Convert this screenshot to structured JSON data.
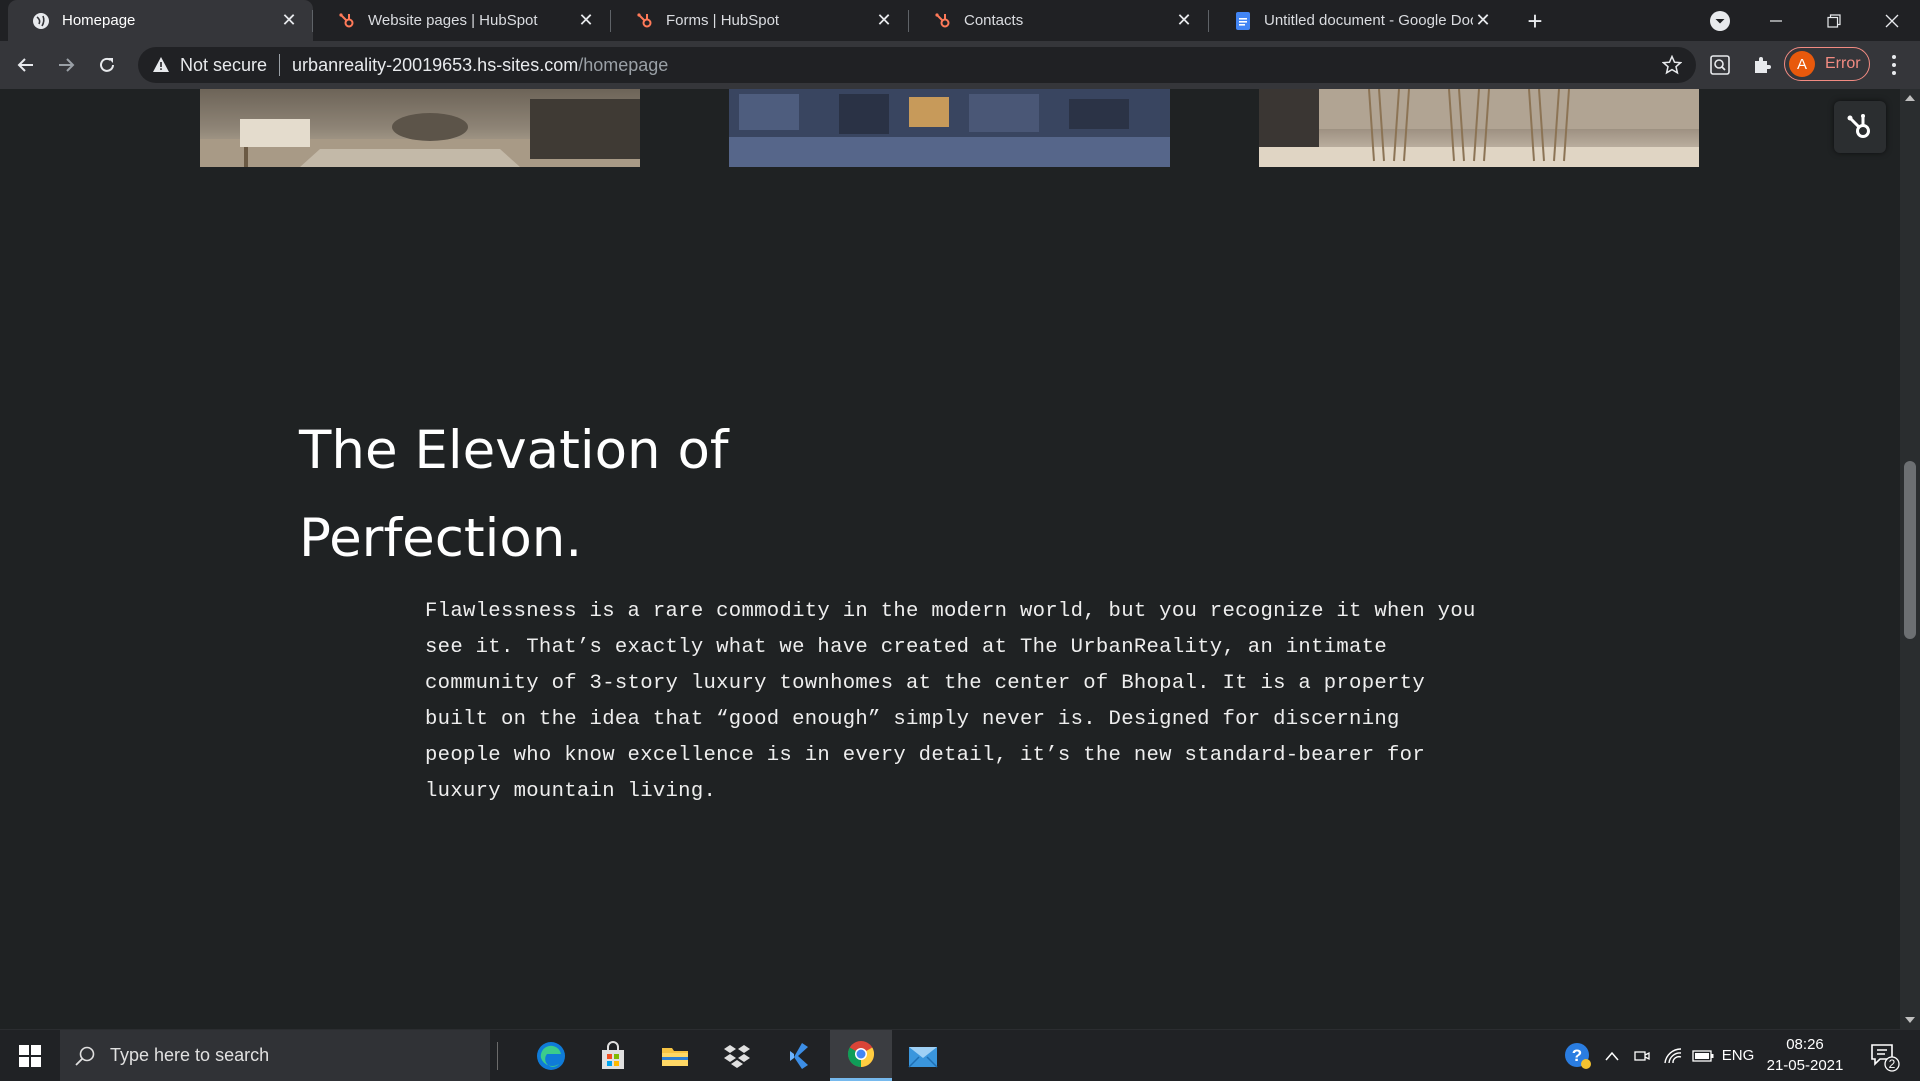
{
  "browser": {
    "tabs": [
      {
        "title": "Homepage",
        "favicon": "globe-icon",
        "active": true
      },
      {
        "title": "Website pages | HubSpot",
        "favicon": "hubspot-icon",
        "active": false
      },
      {
        "title": "Forms | HubSpot",
        "favicon": "hubspot-icon",
        "active": false
      },
      {
        "title": "Contacts",
        "favicon": "hubspot-icon",
        "active": false
      },
      {
        "title": "Untitled document - Google Docs",
        "favicon": "google-docs-icon",
        "active": false
      }
    ],
    "address": {
      "security_label": "Not secure",
      "host": "urbanreality-20019653.hs-sites.com",
      "path": "/homepage"
    },
    "profile": {
      "initial": "A",
      "status": "Error"
    }
  },
  "page": {
    "headline_line1": "The Elevation of",
    "headline_line2": "Perfection.",
    "body": "Flawlessness is a rare commodity in the modern world, but you recognize it when you see it. That’s exactly what we have created at The UrbanReality, an intimate community of 3-story luxury townhomes at the center of Bhopal. It is a property built on the idea that “good enough” simply never is. Designed for discerning people who know excellence is in every detail, it’s the new standard-bearer for luxury mountain living."
  },
  "taskbar": {
    "search_placeholder": "Type here to search",
    "apps": [
      "edge-icon",
      "store-icon",
      "file-explorer-icon",
      "dropbox-icon",
      "visual-studio-icon",
      "chrome-icon",
      "mail-icon"
    ],
    "tray": {
      "language": "ENG",
      "time": "08:26",
      "date": "21-05-2021",
      "notification_count": "2"
    }
  },
  "colors": {
    "page_bg": "#1f2223",
    "tab_bg": "#202124",
    "toolbar_bg": "#35363a",
    "hubspot_orange": "#ff7a59",
    "error_red": "#f28b82"
  }
}
